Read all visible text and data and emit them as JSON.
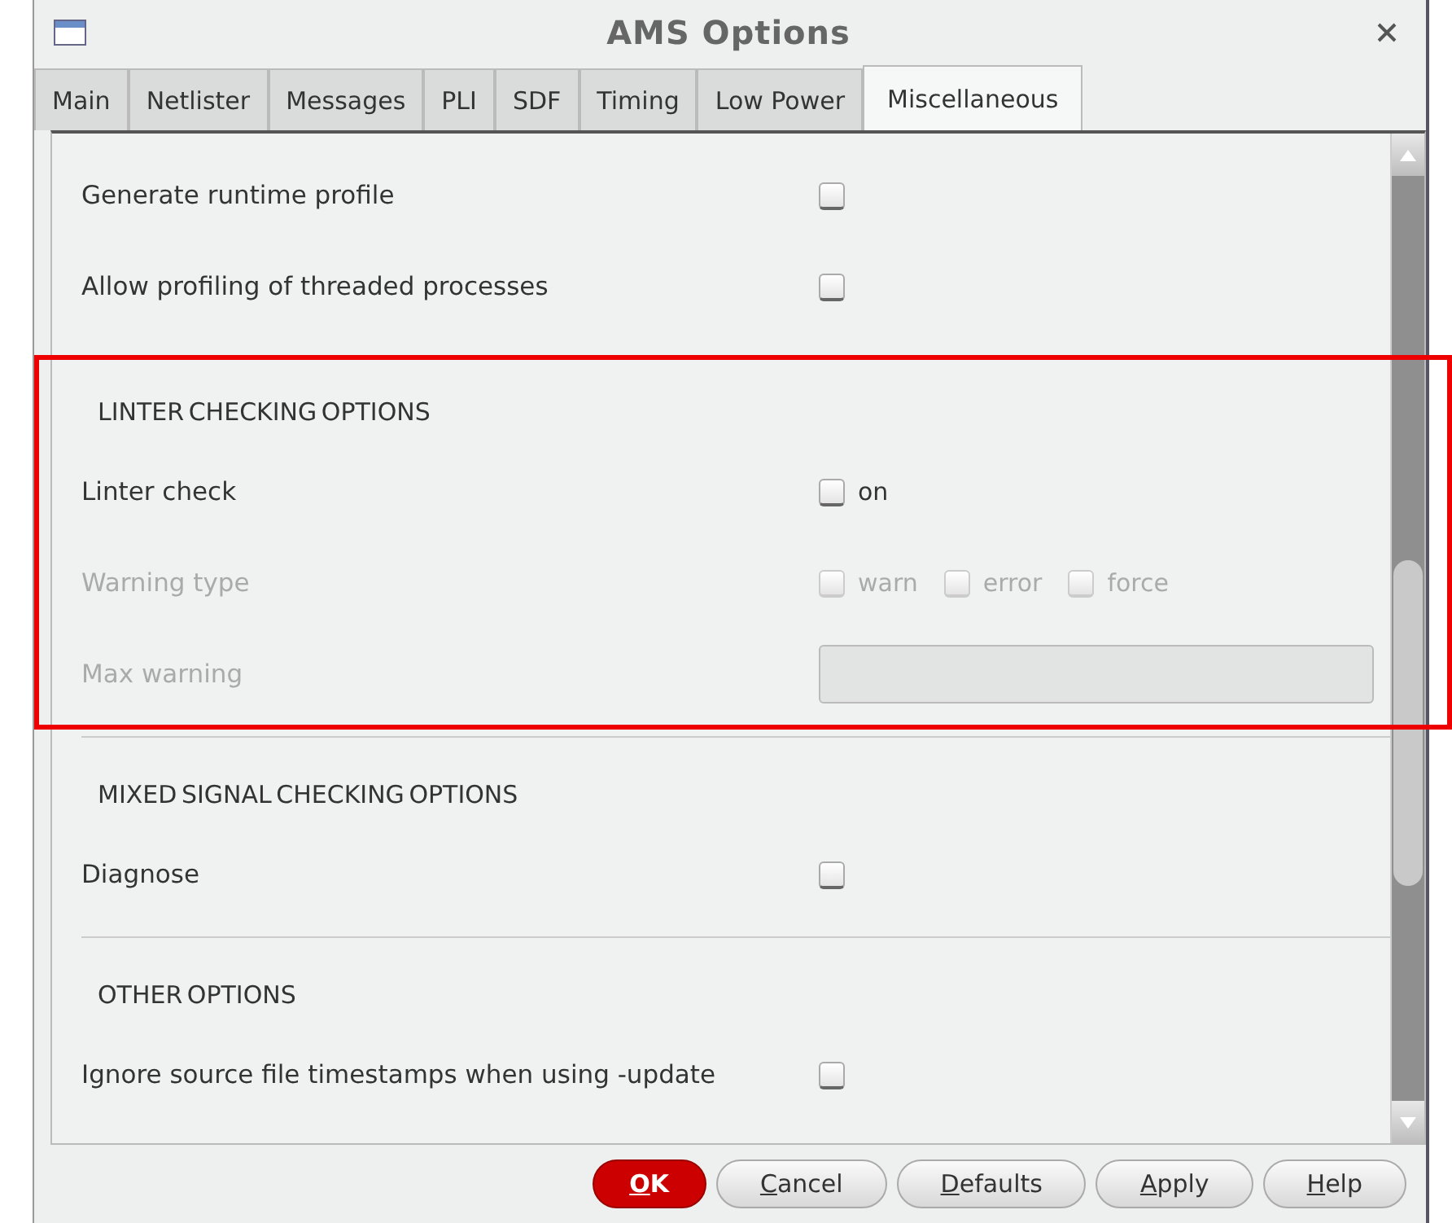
{
  "window": {
    "title": "AMS Options"
  },
  "tabs": [
    {
      "label": "Main",
      "selected": false
    },
    {
      "label": "Netlister",
      "selected": false
    },
    {
      "label": "Messages",
      "selected": false
    },
    {
      "label": "PLI",
      "selected": false
    },
    {
      "label": "SDF",
      "selected": false
    },
    {
      "label": "Timing",
      "selected": false
    },
    {
      "label": "Low Power",
      "selected": false
    },
    {
      "label": "Miscellaneous",
      "selected": true
    }
  ],
  "sections": [
    {
      "highlighted": false,
      "rows": [
        {
          "kind": "checkbox",
          "label": "Generate runtime profile",
          "disabled": false,
          "options": [
            {
              "checked": false
            }
          ]
        },
        {
          "kind": "checkbox",
          "label": "Allow profiling of threaded processes",
          "disabled": false,
          "options": [
            {
              "checked": false
            }
          ]
        }
      ]
    },
    {
      "heading": "LINTER CHECKING OPTIONS",
      "highlighted": true,
      "rows": [
        {
          "kind": "checkbox",
          "label": "Linter check",
          "disabled": false,
          "options": [
            {
              "label": "on",
              "checked": false
            }
          ]
        },
        {
          "kind": "checkbox",
          "label": "Warning type",
          "disabled": true,
          "options": [
            {
              "label": "warn",
              "checked": false
            },
            {
              "label": "error",
              "checked": false
            },
            {
              "label": "force",
              "checked": false
            }
          ]
        },
        {
          "kind": "text",
          "label": "Max warning",
          "disabled": true
        }
      ]
    },
    {
      "heading": "MIXED SIGNAL CHECKING OPTIONS",
      "highlighted": false,
      "rows": [
        {
          "kind": "checkbox",
          "label": "Diagnose",
          "disabled": false,
          "options": [
            {
              "checked": false
            }
          ]
        }
      ]
    },
    {
      "heading": "OTHER OPTIONS",
      "highlighted": false,
      "rows": [
        {
          "kind": "checkbox",
          "label": "Ignore source file timestamps when using -update",
          "disabled": false,
          "options": [
            {
              "checked": false
            }
          ]
        }
      ]
    }
  ],
  "buttons": [
    {
      "label": "OK",
      "primary": true
    },
    {
      "label": "Cancel",
      "primary": false
    },
    {
      "label": "Defaults",
      "primary": false
    },
    {
      "label": "Apply",
      "primary": false
    },
    {
      "label": "Help",
      "primary": false
    }
  ]
}
